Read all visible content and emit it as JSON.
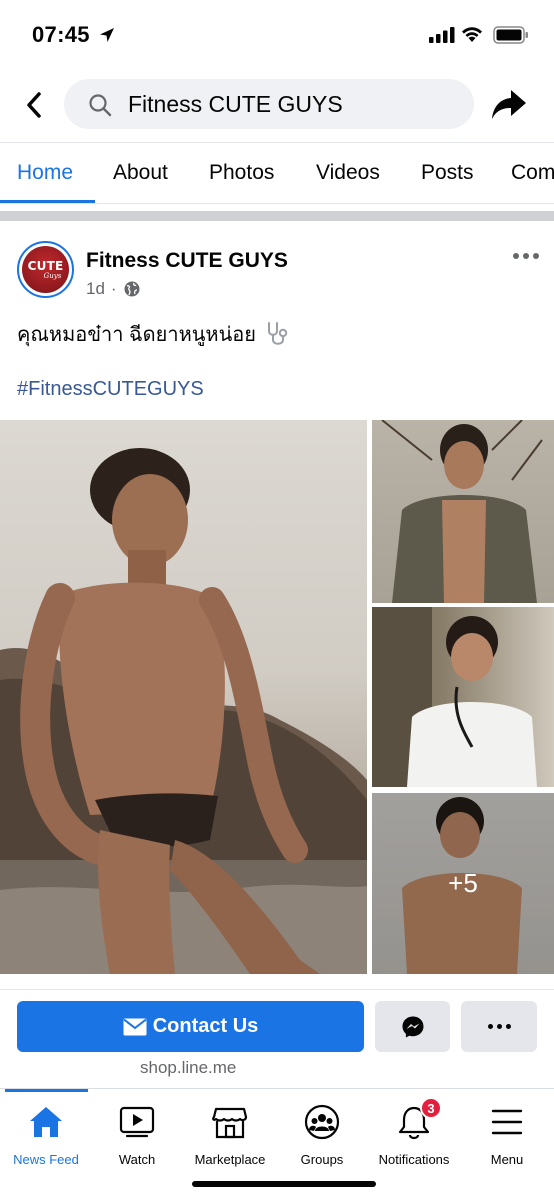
{
  "status_bar": {
    "time": "07:45"
  },
  "header": {
    "search_value": "Fitness CUTE GUYS"
  },
  "tabs": [
    {
      "label": "Home",
      "active": true
    },
    {
      "label": "About"
    },
    {
      "label": "Photos"
    },
    {
      "label": "Videos"
    },
    {
      "label": "Posts"
    },
    {
      "label": "Com"
    }
  ],
  "post": {
    "page_name": "Fitness CUTE GUYS",
    "avatar_text": "CUTE",
    "avatar_subtext": "Guys",
    "time": "1d",
    "text": "คุณหมอข๋าา ฉีดยาหนูหน่อย",
    "hashtag": "#FitnessCUTEGUYS",
    "more_photos": "+5"
  },
  "cta": {
    "contact_label": "Contact Us",
    "link": "shop.line.me"
  },
  "bottom_nav": [
    {
      "label": "News Feed",
      "icon": "home-icon",
      "active": true
    },
    {
      "label": "Watch",
      "icon": "watch-icon"
    },
    {
      "label": "Marketplace",
      "icon": "marketplace-icon"
    },
    {
      "label": "Groups",
      "icon": "groups-icon"
    },
    {
      "label": "Notifications",
      "icon": "bell-icon",
      "badge": "3"
    },
    {
      "label": "Menu",
      "icon": "menu-icon"
    }
  ],
  "colors": {
    "accent": "#1b74e4",
    "badge": "#e41e3f",
    "hashtag": "#385898"
  }
}
